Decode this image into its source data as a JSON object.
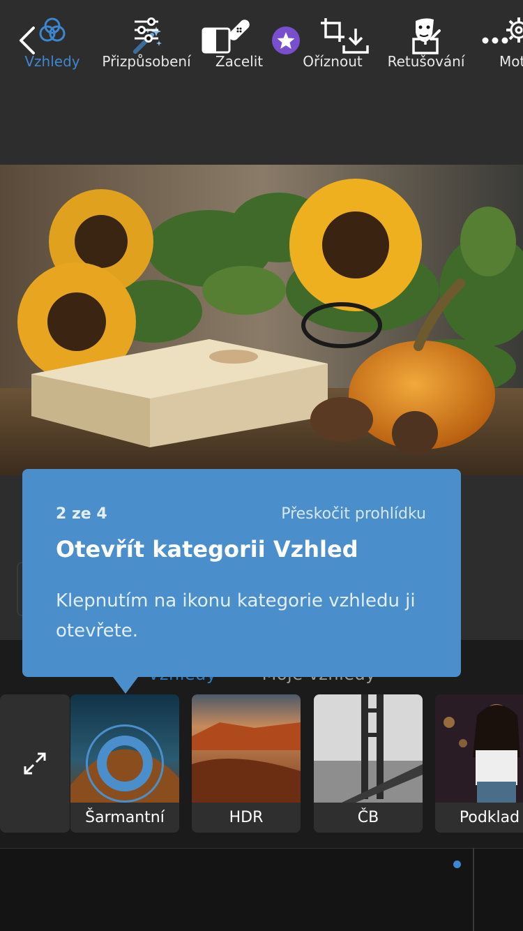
{
  "colors": {
    "accent": "#4a8fcb",
    "nav_active": "#3d86d0",
    "star_badge": "#7a4fcf"
  },
  "topbar": {
    "icons": [
      "back-icon",
      "magic-wand-icon",
      "compare-icon",
      "star-badge-icon",
      "download-icon",
      "share-icon",
      "more-icon"
    ]
  },
  "tabs_peek": {
    "selected": "Vzhledy",
    "other": "Moje vzhledy"
  },
  "tooltip": {
    "step": "2 ze 4",
    "skip": "Přeskočit prohlídku",
    "title": "Otevřít kategorii Vzhled",
    "body": "Klepnutím na ikonu kategorie vzhledu ji otevřete."
  },
  "looks": [
    {
      "label": "Šarmantní"
    },
    {
      "label": "HDR"
    },
    {
      "label": "ČB"
    },
    {
      "label": "Podklad"
    }
  ],
  "bottom_nav": [
    {
      "label": "Vzhledy",
      "icon": "looks-icon",
      "active": true
    },
    {
      "label": "Přizpůsobení",
      "icon": "sliders-icon"
    },
    {
      "label": "Zacelit",
      "icon": "bandage-icon"
    },
    {
      "label": "Oříznout",
      "icon": "crop-icon"
    },
    {
      "label": "Retušování",
      "icon": "retouch-face-icon",
      "badge": true
    },
    {
      "label": "Mot",
      "icon": "gear-icon"
    }
  ]
}
